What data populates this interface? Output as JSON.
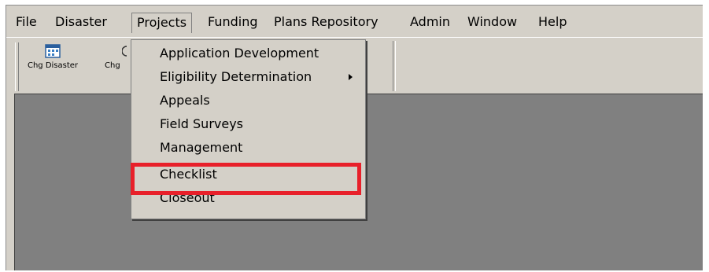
{
  "menubar": {
    "items": [
      "File",
      "Disaster",
      "Projects",
      "Funding",
      "Plans Repository",
      "Admin",
      "Window",
      "Help"
    ]
  },
  "toolbar": {
    "buttons": [
      {
        "label": "Chg Disaster",
        "icon": "calendar-grid-icon"
      },
      {
        "label": "Chg",
        "icon": "clock-icon"
      }
    ]
  },
  "projects_menu": {
    "items": [
      {
        "label": "Application Development",
        "submenu": false
      },
      {
        "label": "Eligibility Determination",
        "submenu": true
      },
      {
        "label": "Appeals",
        "submenu": false
      },
      {
        "label": "Field Surveys",
        "submenu": false
      },
      {
        "label": "Management",
        "submenu": false
      },
      {
        "label": "Checklist",
        "submenu": false,
        "highlighted": true
      },
      {
        "label": "Closeout",
        "submenu": false
      }
    ]
  },
  "colors": {
    "highlight": "#e8202a",
    "chrome": "#d4d0c8",
    "workspace": "#808080"
  }
}
